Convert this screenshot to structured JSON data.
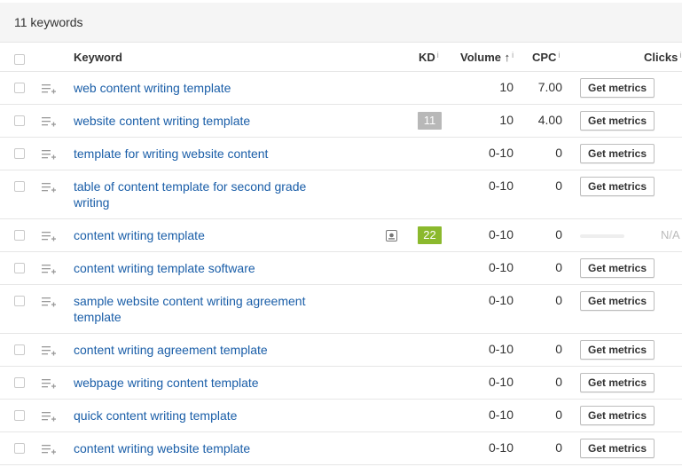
{
  "header": {
    "count_label": "11 keywords"
  },
  "columns": {
    "keyword": "Keyword",
    "kd": "KD",
    "volume": "Volume",
    "cpc": "CPC",
    "clicks": "Clicks",
    "info_mark": "i",
    "sort_arrow": "↑"
  },
  "colors": {
    "link": "#1a5ea8",
    "kd_gray": "#b8b8b8",
    "kd_green": "#8bb92d",
    "header_bg": "#f5f5f5"
  },
  "get_metrics_label": "Get metrics",
  "rows": [
    {
      "line1": "web content writing template",
      "line2": "",
      "kd": "",
      "volume": "10",
      "cpc": "7.00",
      "clicks": "button"
    },
    {
      "line1": "website content writing template",
      "line2": "",
      "kd": "11",
      "volume": "10",
      "cpc": "4.00",
      "clicks": "button"
    },
    {
      "line1": "template for writing website content",
      "line2": "",
      "kd": "",
      "volume": "0-10",
      "cpc": "0",
      "clicks": "button"
    },
    {
      "line1": "table of content template for second grade",
      "line2": "writing",
      "kd": "",
      "volume": "0-10",
      "cpc": "0",
      "clicks": "button"
    },
    {
      "line1": "content writing template",
      "line2": "",
      "kd": "22",
      "volume": "0-10",
      "cpc": "0",
      "clicks": "N/A"
    },
    {
      "line1": "content writing template software",
      "line2": "",
      "kd": "",
      "volume": "0-10",
      "cpc": "0",
      "clicks": "button"
    },
    {
      "line1": "sample website content writing agreement",
      "line2": "template",
      "kd": "",
      "volume": "0-10",
      "cpc": "0",
      "clicks": "button"
    },
    {
      "line1": "content writing agreement template",
      "line2": "",
      "kd": "",
      "volume": "0-10",
      "cpc": "0",
      "clicks": "button"
    },
    {
      "line1": "webpage writing content template",
      "line2": "",
      "kd": "",
      "volume": "0-10",
      "cpc": "0",
      "clicks": "button"
    },
    {
      "line1": "quick content writing template",
      "line2": "",
      "kd": "",
      "volume": "0-10",
      "cpc": "0",
      "clicks": "button"
    },
    {
      "line1": "content writing website template",
      "line2": "",
      "kd": "",
      "volume": "0-10",
      "cpc": "0",
      "clicks": "button"
    }
  ]
}
